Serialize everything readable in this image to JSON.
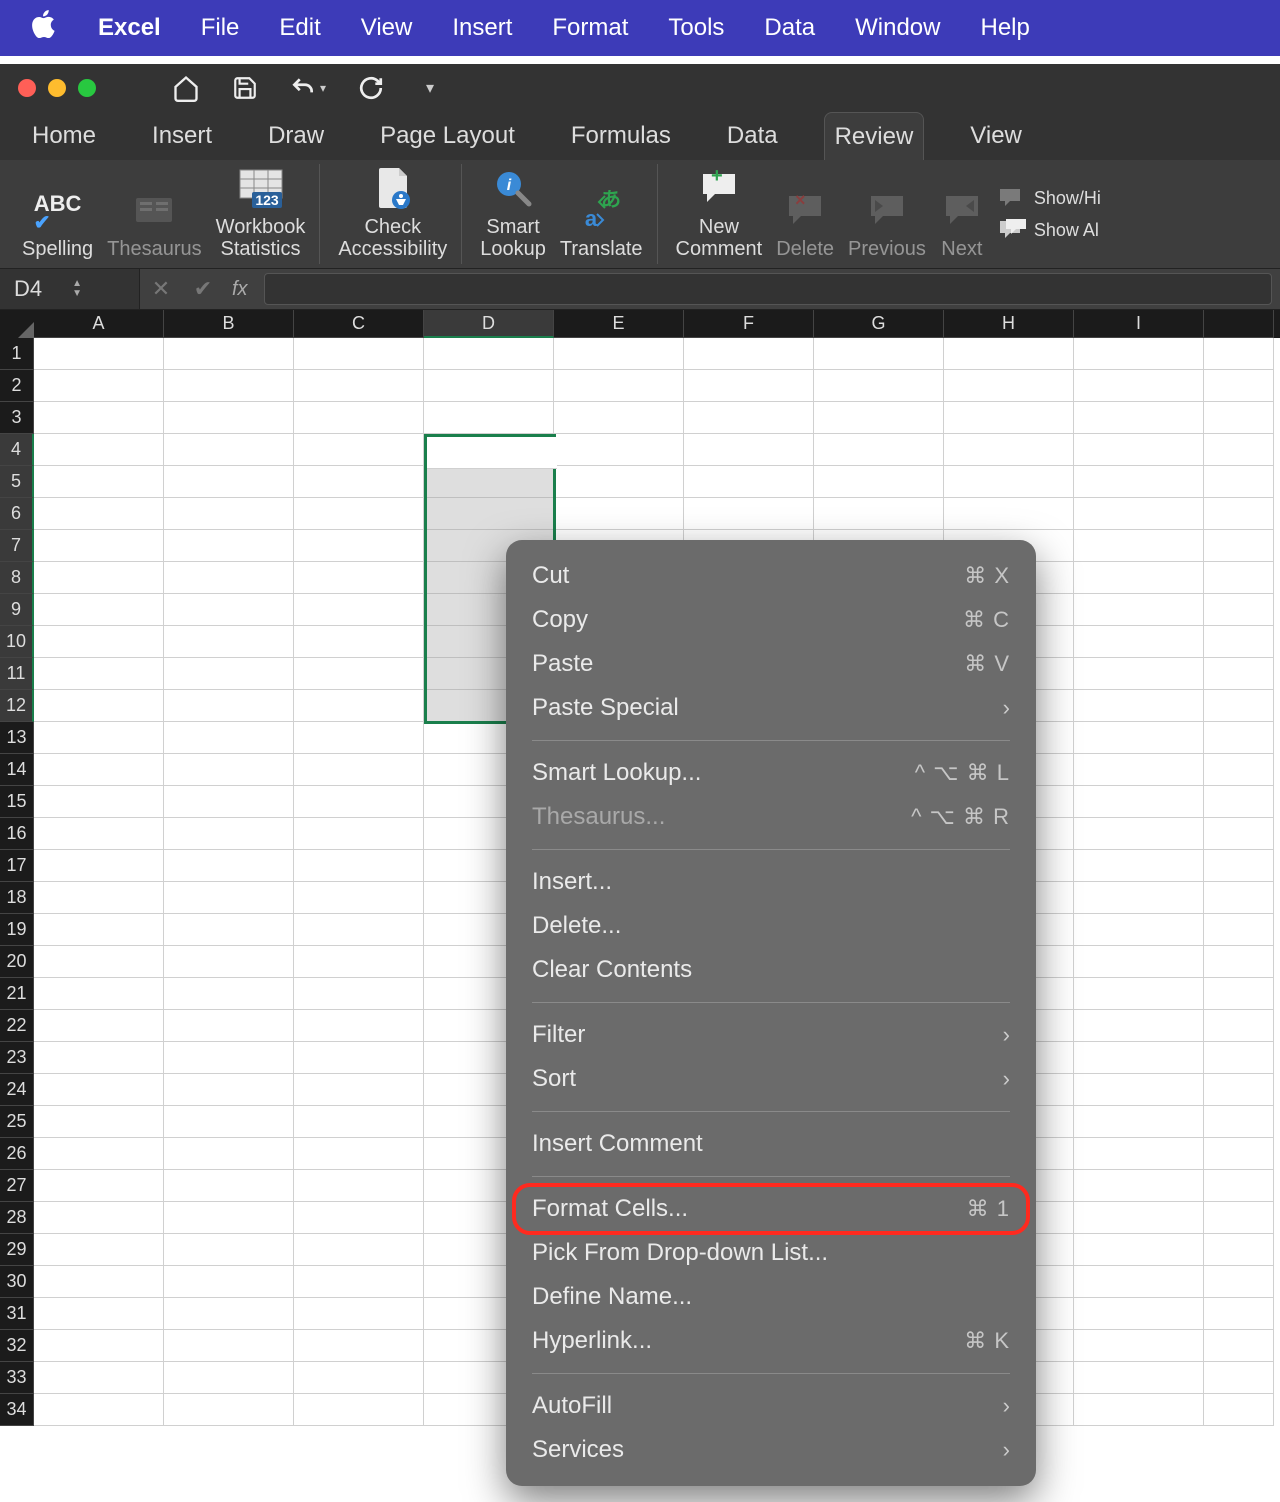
{
  "menubar": {
    "app": "Excel",
    "items": [
      "File",
      "Edit",
      "View",
      "Insert",
      "Format",
      "Tools",
      "Data",
      "Window",
      "Help"
    ]
  },
  "ribbon_tabs": [
    "Home",
    "Insert",
    "Draw",
    "Page Layout",
    "Formulas",
    "Data",
    "Review",
    "View"
  ],
  "active_tab": "Review",
  "ribbon": {
    "spelling": "Spelling",
    "thesaurus": "Thesaurus",
    "workbook_stats": "Workbook\nStatistics",
    "check_access": "Check\nAccessibility",
    "smart_lookup": "Smart\nLookup",
    "translate": "Translate",
    "new_comment": "New\nComment",
    "delete": "Delete",
    "previous": "Previous",
    "next": "Next",
    "show_hide": "Show/Hi",
    "show_all": "Show Al"
  },
  "namebox": "D4",
  "columns": [
    "A",
    "B",
    "C",
    "D",
    "E",
    "F",
    "G",
    "H",
    "I"
  ],
  "rows_count": 34,
  "selection": {
    "col": "D",
    "row_start": 4,
    "row_end": 12
  },
  "context_menu": [
    {
      "label": "Cut",
      "shortcut": "⌘ X"
    },
    {
      "label": "Copy",
      "shortcut": "⌘ C"
    },
    {
      "label": "Paste",
      "shortcut": "⌘ V"
    },
    {
      "label": "Paste Special",
      "submenu": true
    },
    {
      "separator": true
    },
    {
      "label": "Smart Lookup...",
      "shortcut": "^ ⌥ ⌘ L"
    },
    {
      "label": "Thesaurus...",
      "shortcut": "^ ⌥ ⌘ R",
      "disabled": true
    },
    {
      "separator": true
    },
    {
      "label": "Insert..."
    },
    {
      "label": "Delete..."
    },
    {
      "label": "Clear Contents"
    },
    {
      "separator": true
    },
    {
      "label": "Filter",
      "submenu": true
    },
    {
      "label": "Sort",
      "submenu": true
    },
    {
      "separator": true
    },
    {
      "label": "Insert Comment"
    },
    {
      "separator": true
    },
    {
      "label": "Format Cells...",
      "shortcut": "⌘ 1",
      "highlighted": true
    },
    {
      "label": "Pick From Drop-down List..."
    },
    {
      "label": "Define Name..."
    },
    {
      "label": "Hyperlink...",
      "shortcut": "⌘ K"
    },
    {
      "separator": true
    },
    {
      "label": "AutoFill",
      "submenu": true
    },
    {
      "label": "Services",
      "submenu": true
    }
  ]
}
